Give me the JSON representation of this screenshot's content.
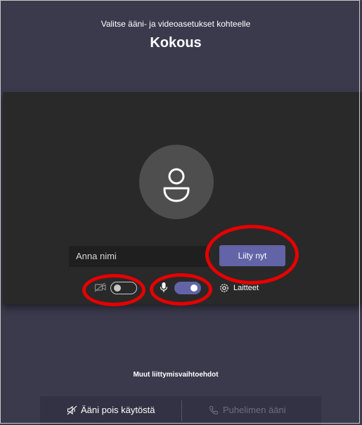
{
  "header": {
    "subtitle": "Valitse ääni- ja videoasetukset kohteelle",
    "meeting_title": "Kokous"
  },
  "prejoin": {
    "name_placeholder": "Anna nimi",
    "join_label": "Liity nyt",
    "camera_enabled": false,
    "mic_enabled": true,
    "devices_label": "Laitteet"
  },
  "other_options": {
    "heading": "Muut liittymisvaihtoehdot",
    "audio_off_label": "Ääni pois käytöstä",
    "phone_audio_label": "Puhelimen ääni"
  },
  "colors": {
    "background": "#3b3a4d",
    "stage": "#292929",
    "accent": "#6264a7",
    "annotation": "#e60000"
  }
}
